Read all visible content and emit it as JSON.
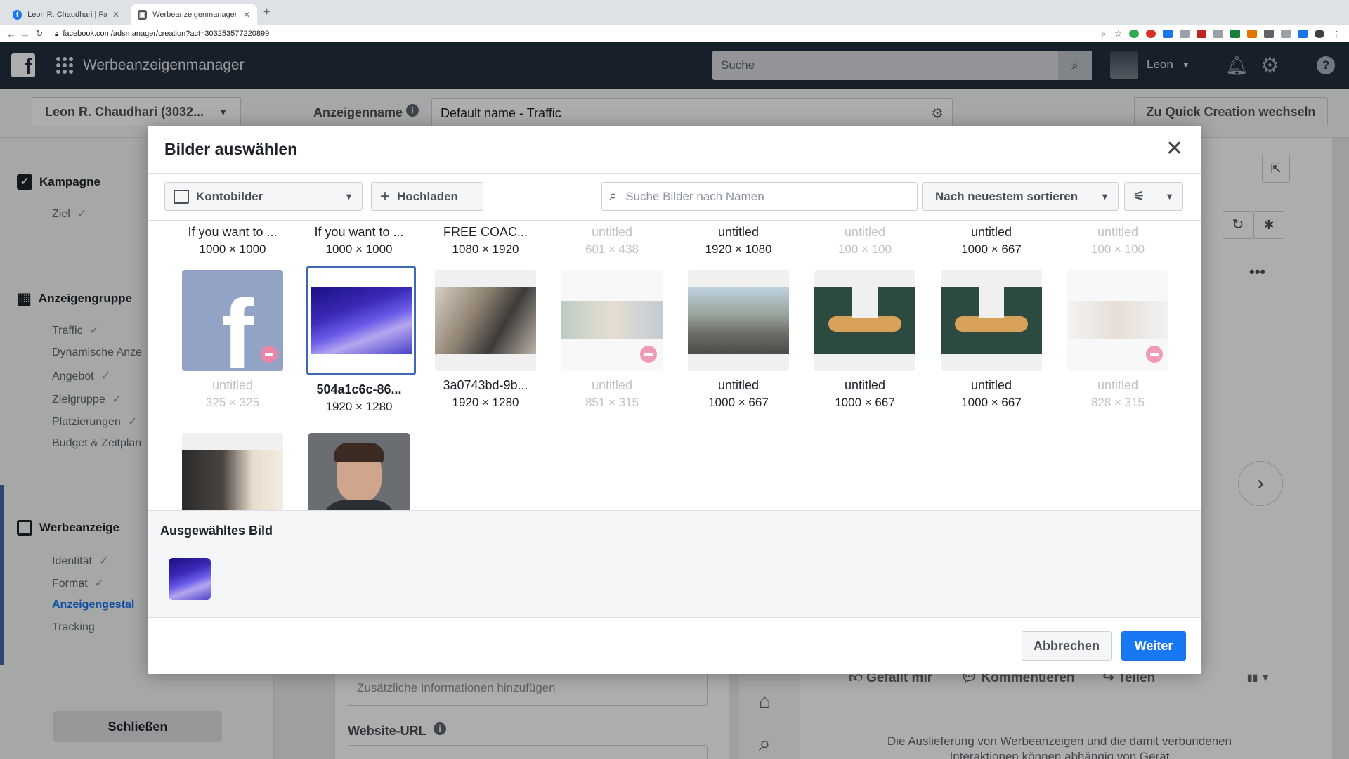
{
  "browser": {
    "tabs": [
      {
        "title": "Leon R. Chaudhari | Facebook"
      },
      {
        "title": "Werbeanzeigenmanager - Cre..."
      }
    ],
    "url": "facebook.com/adsmanager/creation?act=303253577220899"
  },
  "header": {
    "app_title": "Werbeanzeigenmanager",
    "search_placeholder": "Suche",
    "user_name": "Leon"
  },
  "page": {
    "account_selector": "Leon R. Chaudhari (3032...",
    "ad_name_label": "Anzeigenname",
    "ad_name_value": "Default name - Traffic",
    "quick_creation": "Zu Quick Creation wechseln",
    "close_label": "Schließen",
    "extra_info_placeholder": "Zusätzliche Informationen hinzufügen",
    "website_url_label": "Website-URL",
    "preview_actions": [
      "Gefällt mir",
      "Kommentieren",
      "Teilen"
    ],
    "disclaimer": "Die Auslieferung von Werbeanzeigen und die damit verbundenen Interaktionen können abhängig von Gerät"
  },
  "left_nav": {
    "campaign": {
      "label": "Kampagne",
      "items": [
        "Ziel"
      ]
    },
    "adset": {
      "label": "Anzeigengruppe",
      "items": [
        "Traffic",
        "Dynamische Anze",
        "Angebot",
        "Zielgruppe",
        "Platzierungen",
        "Budget & Zeitplan"
      ]
    },
    "ad": {
      "label": "Werbeanzeige",
      "items": [
        "Identität",
        "Format",
        "Anzeigengestal",
        "Tracking"
      ]
    }
  },
  "modal": {
    "title": "Bilder auswählen",
    "source_dropdown": "Kontobilder",
    "upload_button": "Hochladen",
    "search_placeholder": "Suche Bilder nach Namen",
    "sort_dropdown": "Nach neuestem sortieren",
    "top_row": [
      {
        "name": "If you want to ...",
        "dim": "1000 × 1000",
        "disabled": false
      },
      {
        "name": "If you want to ...",
        "dim": "1000 × 1000",
        "disabled": false
      },
      {
        "name": "FREE COAC...",
        "dim": "1080 × 1920",
        "disabled": false
      },
      {
        "name": "untitled",
        "dim": "601 × 438",
        "disabled": true
      },
      {
        "name": "untitled",
        "dim": "1920 × 1080",
        "disabled": false
      },
      {
        "name": "untitled",
        "dim": "100 × 100",
        "disabled": true
      },
      {
        "name": "untitled",
        "dim": "1000 × 667",
        "disabled": false
      },
      {
        "name": "untitled",
        "dim": "100 × 100",
        "disabled": true
      }
    ],
    "middle_row": [
      {
        "name": "untitled",
        "dim": "325 × 325",
        "disabled": true,
        "icon": "facebook-logo"
      },
      {
        "name": "504a1c6c-86...",
        "dim": "1920 × 1280",
        "disabled": false,
        "selected": true
      },
      {
        "name": "3a0743bd-9b...",
        "dim": "1920 × 1280",
        "disabled": false
      },
      {
        "name": "untitled",
        "dim": "851 × 315",
        "disabled": true
      },
      {
        "name": "untitled",
        "dim": "1000 × 667",
        "disabled": false
      },
      {
        "name": "untitled",
        "dim": "1000 × 667",
        "disabled": false
      },
      {
        "name": "untitled",
        "dim": "1000 × 667",
        "disabled": false
      },
      {
        "name": "untitled",
        "dim": "828 × 315",
        "disabled": true
      }
    ],
    "selected_section_title": "Ausgewähltes Bild",
    "cancel_button": "Abbrechen",
    "next_button": "Weiter"
  },
  "colors": {
    "fb_header": "#232f3e",
    "primary_blue": "#1877f2",
    "selected_border": "#4267b2",
    "blocked_red": "#e0245e"
  }
}
